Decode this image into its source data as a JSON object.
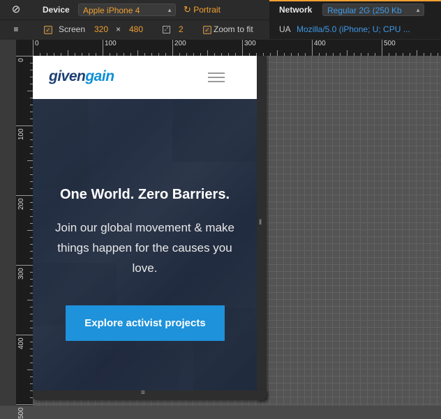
{
  "toolbar": {
    "device_label": "Device",
    "device_value": "Apple iPhone 4",
    "orientation": "Portrait",
    "network_label": "Network",
    "network_value": "Regular 2G (250 Kb",
    "screen_label": "Screen",
    "screen_width": "320",
    "times": "×",
    "screen_height": "480",
    "dpr_value": "2",
    "zoom_to_fit_label": "Zoom to fit",
    "ua_label": "UA",
    "ua_value": "Mozilla/5.0 (iPhone; U; CPU ..."
  },
  "ruler": {
    "h_labels": [
      "0",
      "100",
      "200",
      "300",
      "400",
      "500"
    ],
    "v_labels": [
      "0",
      "100",
      "200",
      "300",
      "400",
      "500"
    ]
  },
  "site": {
    "logo_part1": "given",
    "logo_part2": "gain",
    "hero_title": "One World. Zero Barriers.",
    "hero_subtitle": "Join our global movement & make things happen for the causes you love.",
    "cta_label": "Explore activist projects"
  },
  "colors": {
    "accent_orange": "#f0a030",
    "ua_blue": "#3d9ae8",
    "logo_dark": "#1d3f72",
    "logo_light": "#0d8fd6",
    "cta_blue": "#1e92da"
  },
  "icons": {
    "emulation": "no-entry-icon",
    "drawer": "drawer-toggle-icon",
    "rotate": "rotate-icon",
    "menu": "hamburger-menu-icon"
  }
}
